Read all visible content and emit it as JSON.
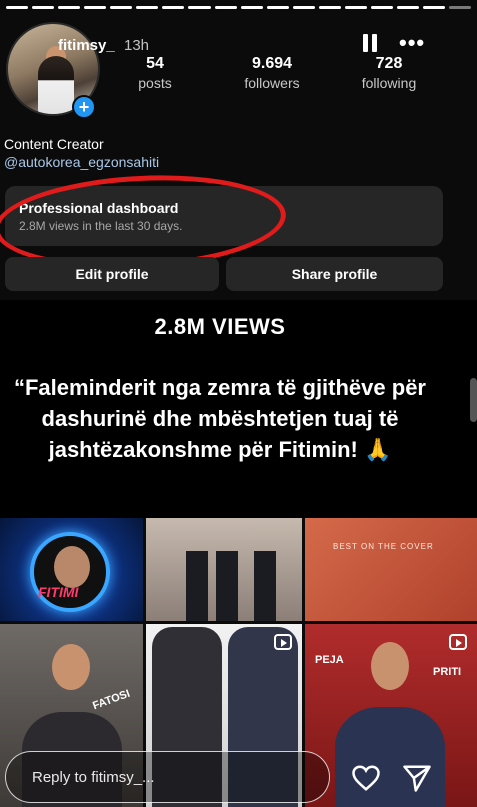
{
  "story": {
    "segments_total": 18,
    "segments_done": 17
  },
  "header": {
    "username": "fitimsy_",
    "time": "13h"
  },
  "stats": [
    {
      "num": "54",
      "label": "posts"
    },
    {
      "num": "9.694",
      "label": "followers"
    },
    {
      "num": "728",
      "label": "following"
    }
  ],
  "bio": {
    "role": "Content Creator",
    "link": "@autokorea_egzonsahiti"
  },
  "dashboard": {
    "title": "Professional dashboard",
    "subtitle": "2.8M views in the last 30 days."
  },
  "buttons": {
    "edit": "Edit profile",
    "share": "Share profile"
  },
  "overlay": {
    "title": "2.8M VIEWS",
    "quote": "“Faleminderit nga zemra të gjithëve për dashurinë dhe mbështetjen tuaj të jashtëzakonshme për Fitimin! 🙏"
  },
  "grid": {
    "fitimi_label": "FITIMI",
    "cover_text": "BEST ON THE COVER",
    "fatosi_label": "FATOSI",
    "peja_label": "PEJA",
    "priti_label": "PRITI"
  },
  "reply": {
    "placeholder": "Reply to fitimsy_..."
  },
  "colors": {
    "annotation_red": "#e01b1b",
    "add_badge_blue": "#2196f3",
    "link_blue": "#a9c7e8"
  }
}
